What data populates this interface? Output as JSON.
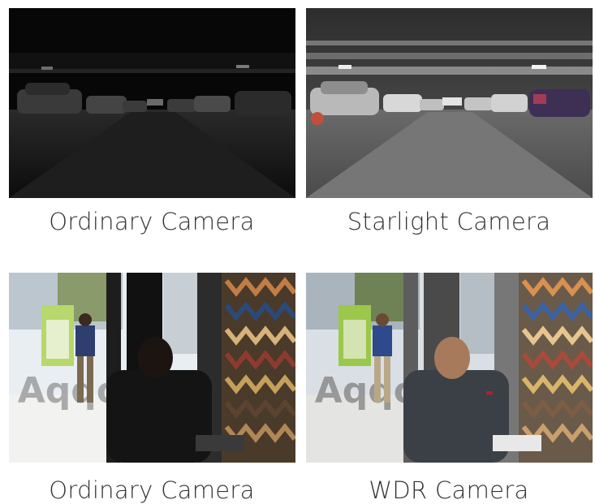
{
  "panels": [
    {
      "caption": "Ordinary Camera",
      "scene": "dark-parking-garage"
    },
    {
      "caption": "Starlight Camera",
      "scene": "bright-parking-garage"
    },
    {
      "caption": "Ordinary Camera",
      "scene": "backlit-window-dark"
    },
    {
      "caption": "WDR Camera",
      "scene": "backlit-window-balanced"
    }
  ],
  "colors": {
    "caption_text": "#333333",
    "background": "#ffffff"
  }
}
